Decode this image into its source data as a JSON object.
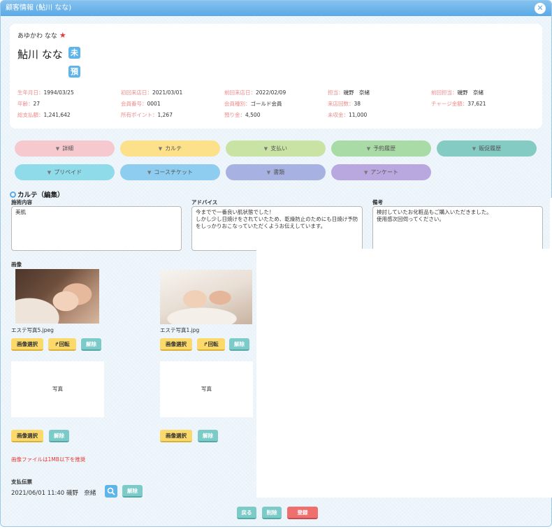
{
  "window": {
    "title": "顧客情報 (鮎川 なな)",
    "close_glyph": "✕"
  },
  "customer": {
    "kana": "あゆかわ なな",
    "star": "★",
    "name": "鮎川 なな",
    "badges": [
      "未",
      "預"
    ]
  },
  "info": [
    {
      "label": "生年月日：",
      "value": "1994/03/25"
    },
    {
      "label": "初回来店日：",
      "value": "2021/03/01"
    },
    {
      "label": "前回来店日：",
      "value": "2022/02/09"
    },
    {
      "label": "担当：",
      "value": "磯野　奈緒"
    },
    {
      "label": "前回担当：",
      "value": "磯野　奈緒"
    },
    {
      "label": "年齢：",
      "value": "27"
    },
    {
      "label": "会員番号：",
      "value": "0001"
    },
    {
      "label": "会員種別：",
      "value": "ゴールド会員"
    },
    {
      "label": "来店回数：",
      "value": "38"
    },
    {
      "label": "チャージ金額：",
      "value": "37,621"
    },
    {
      "label": "総支払額：",
      "value": "1,241,642"
    },
    {
      "label": "所有ポイント：",
      "value": "1,267"
    },
    {
      "label": "預り金：",
      "value": "4,500"
    },
    {
      "label": "未収金：",
      "value": "11,000"
    }
  ],
  "tab_glyph": "▼",
  "tabs": [
    {
      "label": "詳細",
      "color": "#f6c9cf"
    },
    {
      "label": "カルテ",
      "color": "#fde08a"
    },
    {
      "label": "支払い",
      "color": "#c9e3a4"
    },
    {
      "label": "予約履歴",
      "color": "#a9dba7"
    },
    {
      "label": "販促履歴",
      "color": "#84cbc3"
    },
    {
      "label": "プリペイド",
      "color": "#8fdbea"
    },
    {
      "label": "コースチケット",
      "color": "#8fcdf0"
    },
    {
      "label": "書類",
      "color": "#a7b2e2"
    },
    {
      "label": "アンケート",
      "color": "#b9a8e0"
    }
  ],
  "karte": {
    "section_title": "カルテ（編集）",
    "treatment_label": "施術内容",
    "treatment_value": "美肌",
    "advice_label": "アドバイス",
    "advice_value": "今までで一番良い肌状態でした！\nしかし少し日焼けをされていたため、乾燥防止のためにも日焼け予防をしっかりおこなっていただくようお伝えしています。",
    "notes_label": "備考",
    "notes_value": "検討していたお化粧品もご購入いただきました。\n使用感次回伺ってください。"
  },
  "images": {
    "label": "画像",
    "file1": "エステ写真5.jpeg",
    "file2": "エステ写真1.jpg",
    "select_label": "画像選択",
    "rotate_label": "回転",
    "remove_label": "解除",
    "placeholder": "写真",
    "warning": "画像ファイルは1MB以下を推奨"
  },
  "payment": {
    "label": "支払伝票",
    "value": "2021/06/01 11:40 磯野　奈緒",
    "remove_label": "解除"
  },
  "footer": {
    "back_label": "戻る",
    "delete_label": "削除",
    "save_label": "登録"
  },
  "colors": {
    "accent": "#5aa9e6",
    "yellow_button": "#fbd96a",
    "teal_button": "#7dcbc9",
    "red_button": "#ef6f6f",
    "info_label": "#f08a8a"
  }
}
